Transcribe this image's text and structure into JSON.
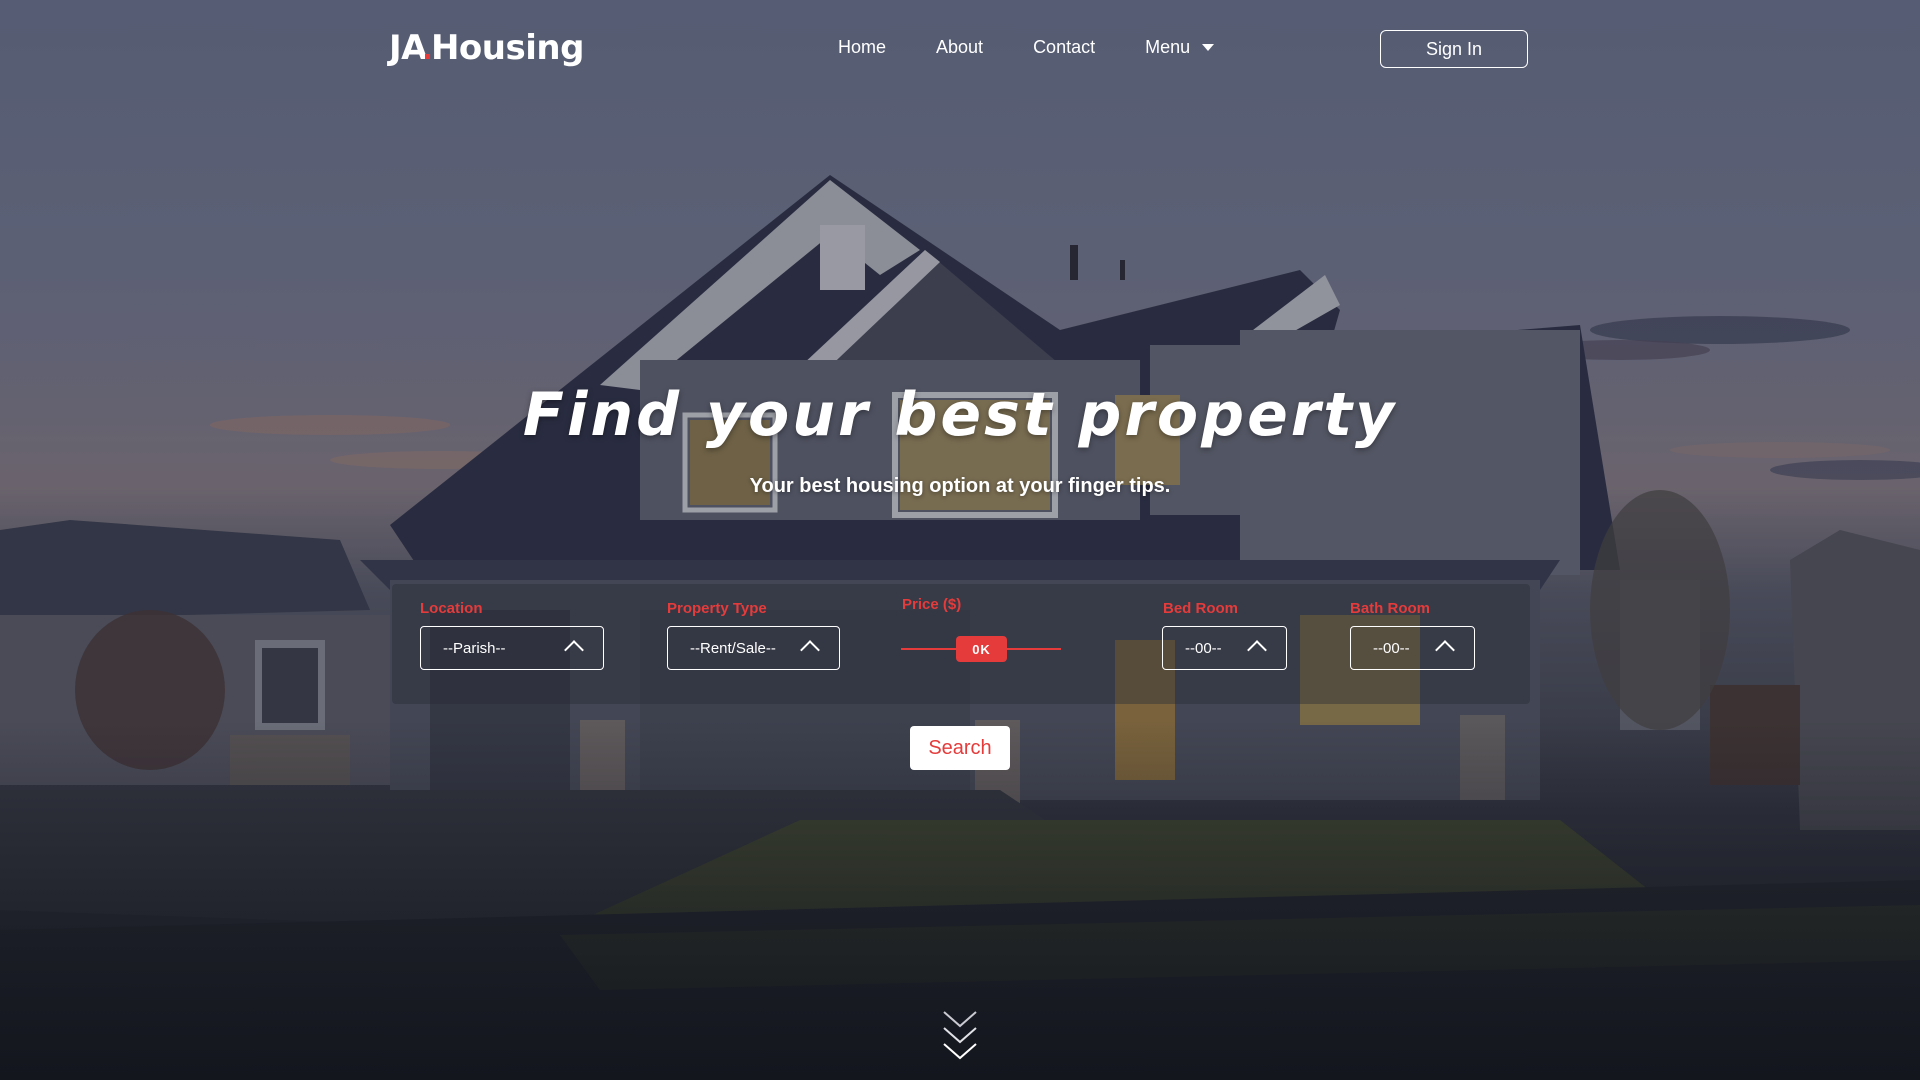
{
  "brand": {
    "prefix": "JA",
    "suffix": "Housing",
    "accent_color": "#e53b3b"
  },
  "nav": {
    "home": "Home",
    "about": "About",
    "contact": "Contact",
    "menu": "Menu"
  },
  "header": {
    "sign_in": "Sign In"
  },
  "hero": {
    "title": "Find your best property",
    "subtitle": "Your best housing option at your finger tips."
  },
  "search_form": {
    "location": {
      "label": "Location",
      "value": "--Parish--"
    },
    "property_type": {
      "label": "Property Type",
      "value": "--Rent/Sale--"
    },
    "price": {
      "label": "Price ($)",
      "value": "0K"
    },
    "bed_room": {
      "label": "Bed Room",
      "value": "--00--"
    },
    "bath_room": {
      "label": "Bath Room",
      "value": "--00--"
    },
    "search_label": "Search"
  },
  "icons": {
    "menu_caret": "caret-down-icon",
    "select_chevron": "chevron-up-icon",
    "scroll": "double-chevron-down-icon"
  }
}
